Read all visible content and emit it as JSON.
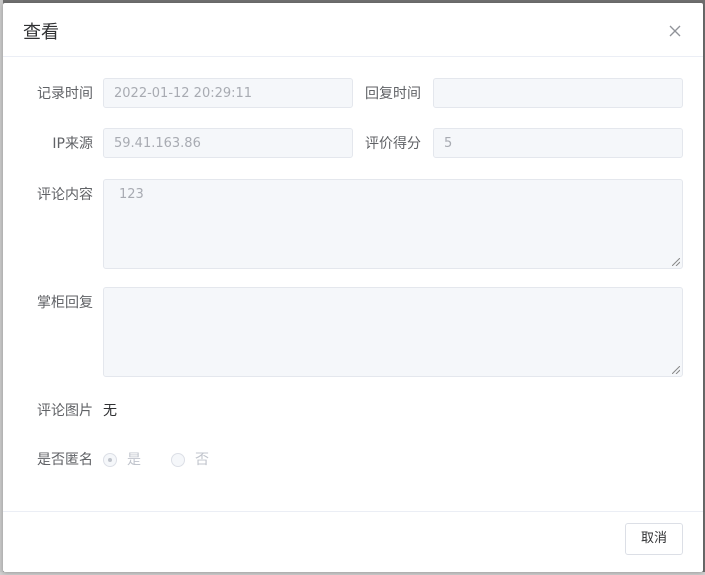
{
  "dialog": {
    "title": "查看",
    "close_icon": "close-icon"
  },
  "form": {
    "record_time": {
      "label": "记录时间",
      "value": "2022-01-12 20:29:11"
    },
    "reply_time": {
      "label": "回复时间",
      "value": ""
    },
    "ip_source": {
      "label": "IP来源",
      "value": "59.41.163.86"
    },
    "rating": {
      "label": "评价得分",
      "value": "5"
    },
    "comment_content": {
      "label": "评论内容",
      "value": "123"
    },
    "owner_reply": {
      "label": "掌柜回复",
      "value": ""
    },
    "comment_images": {
      "label": "评论图片",
      "value": "无"
    },
    "anonymous": {
      "label": "是否匿名",
      "options": [
        "是",
        "否"
      ],
      "selected": "是"
    }
  },
  "footer": {
    "cancel_label": "取消"
  }
}
